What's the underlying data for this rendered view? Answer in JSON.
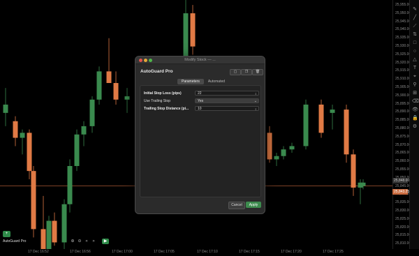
{
  "colors": {
    "bull": "#3a8a4e",
    "bear": "#e07a45",
    "price_line": "#c96b3f",
    "bg": "#000000"
  },
  "chart_data": {
    "type": "candlestick",
    "price_axis_ticks": [
      "25,955.00",
      "25,950.00",
      "25,945.00",
      "25,940.00",
      "25,935.00",
      "25,930.00",
      "25,925.00",
      "25,920.00",
      "25,915.00",
      "25,910.00",
      "25,905.00",
      "25,900.00",
      "25,895.00",
      "25,890.00",
      "25,885.00",
      "25,880.00",
      "25,875.00",
      "25,870.00",
      "25,865.00",
      "25,860.00",
      "25,855.00",
      "25,850.00",
      "25,845.00",
      "25,840.00",
      "25,835.00",
      "25,830.00",
      "25,825.00",
      "25,820.00",
      "25,815.00",
      "25,810.00"
    ],
    "time_axis_ticks": [
      "17 Dec 16:52",
      "17 Dec 16:56",
      "17 Dec 17:00",
      "17 Dec 17:05",
      "17 Dec 17:10",
      "17 Dec 17:15",
      "17 Dec 17:20",
      "17 Dec 17:25"
    ],
    "current_price_label": "25,843.25",
    "ref_price_label": "25,848.00",
    "ylim": [
      25808,
      25958
    ],
    "candles": [
      {
        "o": 25890,
        "h": 25905,
        "l": 25882,
        "c": 25895
      },
      {
        "o": 25885,
        "h": 25888,
        "l": 25870,
        "c": 25875
      },
      {
        "o": 25875,
        "h": 25880,
        "l": 25865,
        "c": 25878
      },
      {
        "o": 25878,
        "h": 25880,
        "l": 25850,
        "c": 25855
      },
      {
        "o": 25855,
        "h": 25858,
        "l": 25815,
        "c": 25820
      },
      {
        "o": 25820,
        "h": 25840,
        "l": 25800,
        "c": 25805
      },
      {
        "o": 25805,
        "h": 25828,
        "l": 25800,
        "c": 25825
      },
      {
        "o": 25825,
        "h": 25830,
        "l": 25810,
        "c": 25812
      },
      {
        "o": 25812,
        "h": 25838,
        "l": 25808,
        "c": 25835
      },
      {
        "o": 25835,
        "h": 25862,
        "l": 25830,
        "c": 25858
      },
      {
        "o": 25858,
        "h": 25880,
        "l": 25855,
        "c": 25877
      },
      {
        "o": 25877,
        "h": 25885,
        "l": 25870,
        "c": 25882
      },
      {
        "o": 25882,
        "h": 25900,
        "l": 25878,
        "c": 25898
      },
      {
        "o": 25898,
        "h": 25918,
        "l": 25895,
        "c": 25915
      },
      {
        "o": 25915,
        "h": 25935,
        "l": 25910,
        "c": 25908
      },
      {
        "o": 25908,
        "h": 25915,
        "l": 25895,
        "c": 25898
      },
      {
        "o": 25898,
        "h": 25905,
        "l": 25890,
        "c": 25900
      },
      {
        "o": 25900,
        "h": 25958,
        "l": 25898,
        "c": 25950
      },
      {
        "o": 25950,
        "h": 25955,
        "l": 25925,
        "c": 25930
      },
      {
        "o": 25878,
        "h": 25882,
        "l": 25860,
        "c": 25862
      },
      {
        "o": 25862,
        "h": 25866,
        "l": 25858,
        "c": 25864
      },
      {
        "o": 25864,
        "h": 25870,
        "l": 25862,
        "c": 25868
      },
      {
        "o": 25868,
        "h": 25872,
        "l": 25866,
        "c": 25870
      },
      {
        "o": 25870,
        "h": 25898,
        "l": 25868,
        "c": 25895
      },
      {
        "o": 25895,
        "h": 25898,
        "l": 25875,
        "c": 25878
      },
      {
        "o": 25890,
        "h": 25895,
        "l": 25880,
        "c": 25892
      },
      {
        "o": 25892,
        "h": 25895,
        "l": 25860,
        "c": 25865
      },
      {
        "o": 25865,
        "h": 25868,
        "l": 25840,
        "c": 25845
      },
      {
        "o": 25845,
        "h": 25850,
        "l": 25835,
        "c": 25848
      },
      {
        "o": 25846,
        "h": 25850,
        "l": 25844,
        "c": 25848
      }
    ]
  },
  "bottom": {
    "symbol": "AutoGuard Pro",
    "badge": "+"
  },
  "dialog": {
    "window_title": "Modify Stock — ...",
    "strategy_name": "AutoGuard Pro",
    "tabs": [
      "Parameters",
      "Automated"
    ],
    "fields": [
      {
        "label": "Initial Stop Loss (pips)",
        "value": "22"
      },
      {
        "label": "Use Trailing Stop",
        "value": "Yes"
      },
      {
        "label": "Trailing Stop Distance (pi...",
        "value": "10"
      }
    ],
    "cancel_label": "Cancel",
    "apply_label": "Apply"
  }
}
